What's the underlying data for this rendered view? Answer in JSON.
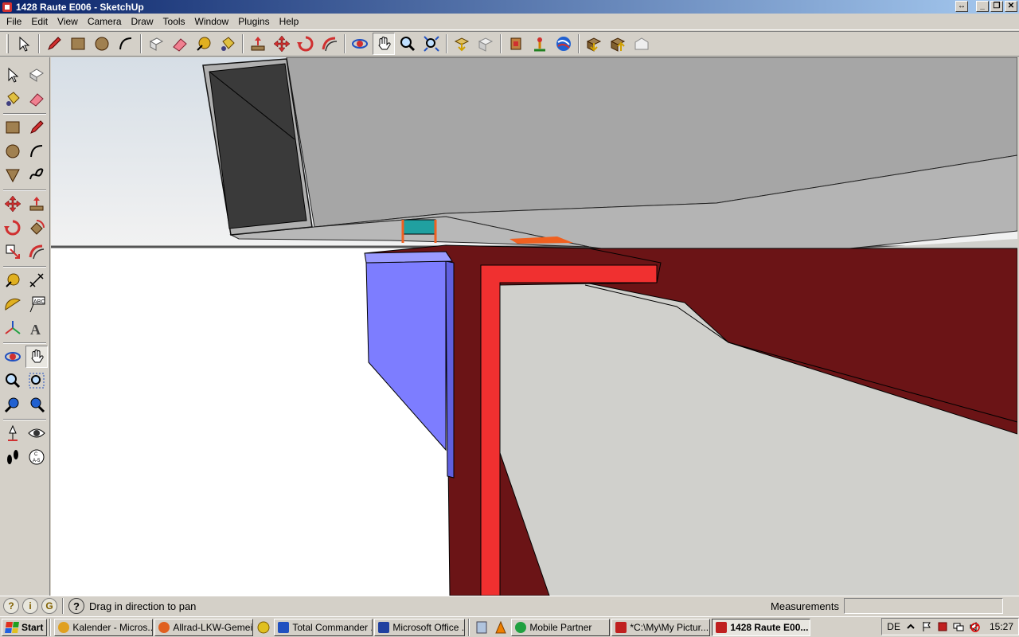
{
  "window": {
    "title": "1428 Raute E006 - SketchUp",
    "buttons": {
      "resize": "↔",
      "minimize": "_",
      "restore": "❐",
      "close": "✕"
    }
  },
  "menu": [
    "File",
    "Edit",
    "View",
    "Camera",
    "Draw",
    "Tools",
    "Window",
    "Plugins",
    "Help"
  ],
  "toolbar_icons": [
    "select-icon",
    "pencil-icon",
    "rectangle-icon",
    "circle-icon",
    "arc-icon",
    "make-component-icon",
    "eraser-icon",
    "tape-measure-icon",
    "paint-bucket-icon",
    "push-pull-icon",
    "move-icon",
    "rotate-icon",
    "follow-me-icon",
    "orbit-icon",
    "pan-icon",
    "zoom-icon",
    "zoom-extents-icon",
    "get-models-icon",
    "share-model-icon",
    "get-current-view-icon",
    "place-model-icon",
    "google-earth-icon",
    "get-components-icon",
    "share-component-icon",
    "warehouse-icon"
  ],
  "status": {
    "hint": "Drag in direction to pan",
    "measurements_label": "Measurements",
    "measurements_value": ""
  },
  "taskbar": {
    "start": "Start",
    "tasks": [
      {
        "label": "Kalender - Micros...",
        "color": "#e0a020"
      },
      {
        "label": "Allrad-LKW-Gemei...",
        "color": "#e06020"
      },
      {
        "label": "Total Commander ...",
        "color": "#2050c0"
      },
      {
        "label": "Microsoft Office ...",
        "color": "#2040a0"
      },
      {
        "label": "Mobile Partner",
        "color": "#20a040"
      },
      {
        "label": "*C:\\My\\My Pictur...",
        "color": "#c02020"
      },
      {
        "label": "1428 Raute E00...",
        "color": "#c02020",
        "active": true
      }
    ],
    "language": "DE",
    "clock": "15:27"
  },
  "colors": {
    "dark_red": "#6b1416",
    "bright_red": "#f03030",
    "blue_face": "#7d7dff",
    "gray_body": "#a6a6a6",
    "ground": "#d0d0cc",
    "teal": "#20a0a0",
    "orange": "#f06020"
  }
}
